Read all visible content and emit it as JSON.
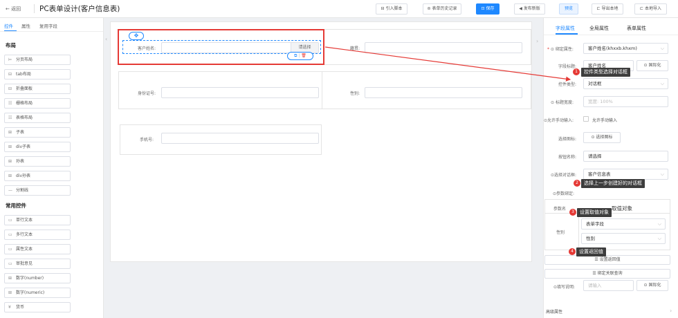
{
  "header": {
    "back_label": "← 返回",
    "title": "PC表单设计(客户信息表)",
    "buttons": {
      "import_script": "引入脚本",
      "history": "表单历史记录",
      "save": "保存",
      "publish": "发布新版",
      "preview": "预览",
      "export_local": "导出本地",
      "import_local": "本地导入"
    }
  },
  "left_panel": {
    "tabs": [
      "控件",
      "属性",
      "复用字段"
    ],
    "sections": [
      {
        "title": "布局",
        "items": [
          {
            "icon": "pagination-layout-icon",
            "glyph": "⊨",
            "label": "分页布局"
          },
          {
            "icon": "tab-layout-icon",
            "glyph": "⊟",
            "label": "tab布局"
          },
          {
            "icon": "collapse-panel-icon",
            "glyph": "⊟",
            "label": "折叠面板"
          },
          {
            "icon": "grid-layout-icon",
            "glyph": "☷",
            "label": "栅格布局"
          },
          {
            "icon": "table-layout-icon",
            "glyph": "☷",
            "label": "表格布局"
          },
          {
            "icon": "subtable-icon",
            "glyph": "⊞",
            "label": "子表"
          },
          {
            "icon": "div-subtable-icon",
            "glyph": "⊞",
            "label": "div子表"
          },
          {
            "icon": "grandchild-table-icon",
            "glyph": "⊞",
            "label": "孙表"
          },
          {
            "icon": "div-grandchild-table-icon",
            "glyph": "⊞",
            "label": "div孙表"
          },
          {
            "icon": "divider-icon",
            "glyph": "—",
            "label": "分割线"
          }
        ]
      },
      {
        "title": "常用控件",
        "items": [
          {
            "icon": "single-line-text-icon",
            "glyph": "▭",
            "label": "单行文本"
          },
          {
            "icon": "multi-line-text-icon",
            "glyph": "▭",
            "label": "多行文本"
          },
          {
            "icon": "attribute-text-icon",
            "glyph": "▭",
            "label": "属性文本"
          },
          {
            "icon": "approval-opinion-icon",
            "glyph": "▭",
            "label": "审批意见"
          },
          {
            "icon": "number-icon",
            "glyph": "⊞",
            "label": "数字(number)"
          },
          {
            "icon": "numeric-icon",
            "glyph": "⊞",
            "label": "数字(numeric)"
          },
          {
            "icon": "currency-icon",
            "glyph": "¥",
            "label": "货币"
          }
        ]
      }
    ]
  },
  "canvas": {
    "fields": {
      "customer_name": {
        "label": "客户姓名:",
        "button": "请选择"
      },
      "nationality": {
        "label": "籍贯:"
      },
      "id_number": {
        "label": "身份证号:"
      },
      "gender": {
        "label": "性别:"
      },
      "phone": {
        "label": "手机号:"
      }
    }
  },
  "right_panel": {
    "tabs": [
      "字段属性",
      "全局属性",
      "表单属性"
    ],
    "props": {
      "bind_attr_label": "绑定属性:",
      "bind_attr_value": "客户姓名(khxxb.khxm)",
      "field_label_label": "字段标题:",
      "field_label_value": "客户姓名",
      "i18n_button": "国际化",
      "control_type_label": "控件类型:",
      "control_type_value": "对话框",
      "title_width_label": "标题宽度:",
      "title_width_placeholder": "宽度: 100%",
      "allow_input_label": "允许手动输入:",
      "allow_input_checkbox_label": "允许手动输入",
      "select_icon_label": "选择图标:",
      "select_icon_button": "选择图标",
      "button_name_label": "按钮名称:",
      "button_name_value": "请选择",
      "select_dialog_label": "选择对话框:",
      "select_dialog_value": "客户信息表",
      "param_binding_label": "参数绑定:",
      "param_table": {
        "col_param": "参数名",
        "col_target": "取值对象",
        "row_name": "性别",
        "source_value": "表单字段",
        "field_value": "性别"
      },
      "set_return_button": "设置返回值",
      "bind_query_button": "绑定关联查询",
      "fill_desc_label": "填写说明:",
      "fill_desc_placeholder": "请输入",
      "advanced_label": "高级属性"
    }
  },
  "annotations": [
    {
      "num": "1",
      "text": "控件类型选择对话框"
    },
    {
      "num": "2",
      "text": "选择上一步创建好的对话框"
    },
    {
      "num": "3",
      "text": "设置取值对象"
    },
    {
      "num": "4",
      "text": "设置返回值"
    }
  ],
  "colors": {
    "accent": "#1e88ff",
    "annotation_red": "#e53935",
    "tooltip_bg": "#3d3d3d"
  }
}
